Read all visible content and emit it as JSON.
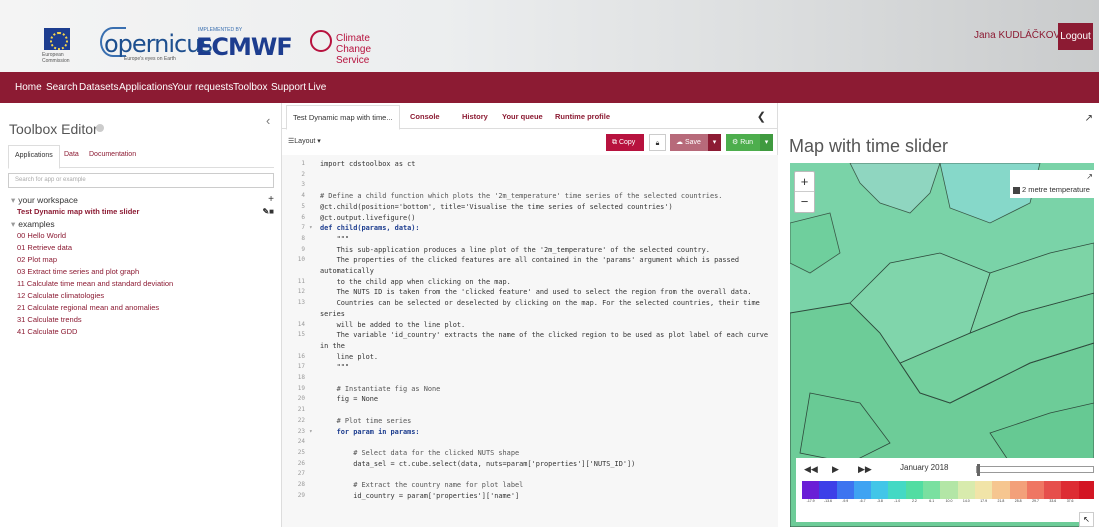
{
  "header": {
    "eu_text": "European Commission",
    "copernicus": "opernicus",
    "copernicus_sub": "Europe's eyes on Earth",
    "implemented_by": "IMPLEMENTED BY",
    "ecmwf": "ECMWF",
    "c3s": "Climate Change Service",
    "user_name": "Jana KUDLÁČKOVÁ",
    "logout": "Logout"
  },
  "nav": [
    "Home",
    "Search",
    "Datasets",
    "Applications",
    "Your requests",
    "Toolbox",
    "Support",
    "Live"
  ],
  "left": {
    "title": "Toolbox Editor",
    "tabs": [
      "Applications",
      "Data",
      "Documentation"
    ],
    "search_placeholder": "Search for app or example",
    "workspace_label": "your workspace",
    "workspace_item": "Test Dynamic map with time slider",
    "examples_label": "examples",
    "examples": [
      "00 Hello World",
      "01 Retrieve data",
      "02 Plot map",
      "03 Extract time series and plot graph",
      "11 Calculate time mean and standard deviation",
      "12 Calculate climatologies",
      "21 Calculate regional mean and anomalies",
      "31 Calculate trends",
      "41 Calculate GDD"
    ]
  },
  "editor": {
    "tabs": [
      "Test Dynamic map with time...",
      "Console",
      "History",
      "Your queue",
      "Runtime profile"
    ],
    "layout": "Layout",
    "copy": "Copy",
    "save": "Save",
    "run": "Run",
    "lines": [
      {
        "n": "1",
        "t": "import cdstoolbox as ct",
        "k": "code"
      },
      {
        "n": "2",
        "t": "",
        "k": "code"
      },
      {
        "n": "3",
        "t": "",
        "k": "code"
      },
      {
        "n": "4",
        "t": "# Define a child function which plots the '2m_temperature' time series of the selected countries.",
        "k": "cmt"
      },
      {
        "n": "5",
        "t": "@ct.child(position='bottom', title='Visualise the time series of selected countries')",
        "k": "code"
      },
      {
        "n": "6",
        "t": "@ct.output.livefigure()",
        "k": "code"
      },
      {
        "n": "7",
        "t": "def child(params, data):",
        "k": "def",
        "fold": "▾"
      },
      {
        "n": "8",
        "t": "    \"\"\"",
        "k": "code"
      },
      {
        "n": "9",
        "t": "    This sub-application produces a line plot of the '2m_temperature' of the selected country.",
        "k": "code"
      },
      {
        "n": "10",
        "t": "    The properties of the clicked features are all contained in the 'params' argument which is passed",
        "k": "code"
      },
      {
        "n": "",
        "t": "automatically",
        "k": "code"
      },
      {
        "n": "11",
        "t": "    to the child app when clicking on the map.",
        "k": "code"
      },
      {
        "n": "12",
        "t": "    The NUTS ID is taken from the 'clicked feature' and used to select the region from the overall data.",
        "k": "code"
      },
      {
        "n": "13",
        "t": "    Countries can be selected or deselected by clicking on the map. For the selected countries, their time",
        "k": "code"
      },
      {
        "n": "",
        "t": "series",
        "k": "code"
      },
      {
        "n": "14",
        "t": "    will be added to the line plot.",
        "k": "code"
      },
      {
        "n": "15",
        "t": "    The variable 'id_country' extracts the name of the clicked region to be used as plot label of each curve",
        "k": "code"
      },
      {
        "n": "",
        "t": "in the",
        "k": "code"
      },
      {
        "n": "16",
        "t": "    line plot.",
        "k": "code"
      },
      {
        "n": "17",
        "t": "    \"\"\"",
        "k": "code"
      },
      {
        "n": "18",
        "t": "",
        "k": "code"
      },
      {
        "n": "19",
        "t": "    # Instantiate fig as None",
        "k": "cmt"
      },
      {
        "n": "20",
        "t": "    fig = None",
        "k": "code"
      },
      {
        "n": "21",
        "t": "",
        "k": "code"
      },
      {
        "n": "22",
        "t": "    # Plot time series",
        "k": "cmt"
      },
      {
        "n": "23",
        "t": "    for param in params:",
        "k": "def",
        "fold": "▾"
      },
      {
        "n": "24",
        "t": "",
        "k": "code"
      },
      {
        "n": "25",
        "t": "        # Select data for the clicked NUTS shape",
        "k": "cmt"
      },
      {
        "n": "26",
        "t": "        data_sel = ct.cube.select(data, nuts=param['properties']['NUTS_ID'])",
        "k": "code"
      },
      {
        "n": "27",
        "t": "",
        "k": "code"
      },
      {
        "n": "28",
        "t": "        # Extract the country name for plot label",
        "k": "cmt"
      },
      {
        "n": "29",
        "t": "        id_country = param['properties']['name']",
        "k": "code"
      }
    ]
  },
  "map": {
    "title": "Map with time slider",
    "layer_label": "2 metre temperature",
    "month": "January 2018",
    "colorbar_colors": [
      "#6a1fd6",
      "#3d3fe8",
      "#3d74f0",
      "#3fa3f2",
      "#42c6e8",
      "#44d9c4",
      "#52dda2",
      "#7ae0a0",
      "#b3e6a6",
      "#d8ebad",
      "#f1e4a8",
      "#f6c690",
      "#f3a07a",
      "#ef7663",
      "#e64f4c",
      "#dd2c33",
      "#d31523"
    ],
    "colorbar_labels": [
      "-17.9",
      "-13.6",
      "-9.9",
      "-6.7",
      "-3.8",
      "-1.0",
      "2.2",
      "6.1",
      "10.0",
      "14.0",
      "17.9",
      "21.8",
      "25.8",
      "29.7",
      "33.6",
      "37.6",
      ""
    ]
  }
}
